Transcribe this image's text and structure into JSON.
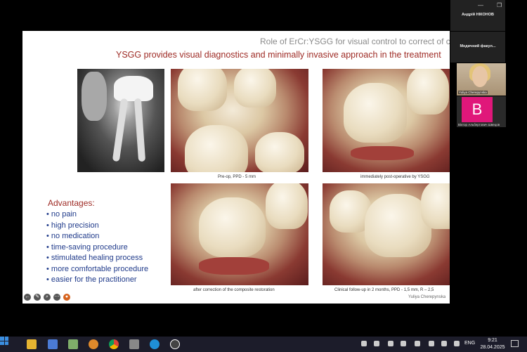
{
  "slide": {
    "header": "Role of ErCr:YSGG for visual control to correct of comp",
    "title": "YSGG provides visual diagnostics and minimally invasive approach in the treatment",
    "captions": [
      "Pre-op, PPD - 5 mm",
      "immediately post-operative by YSGG",
      "after correction of the composite restoration",
      "Clinical follow-up in 2 months, PPD - 1,5 mm, R – 2,5"
    ],
    "advantages_title": "Advantages:",
    "advantages": [
      "no pain",
      "high precision",
      "no medication",
      "time-saving procedure",
      "stimulated healing process",
      "more comfortable procedure",
      "easier for the practitioner"
    ],
    "author": "Yuliya Cherepynska"
  },
  "participants": [
    {
      "name": "Андрій НІКОНОВ"
    },
    {
      "name": "Медичний факул..."
    },
    {
      "name": "Yuliya Cherepynska"
    },
    {
      "name": "Віктор Альбертович Швецов",
      "initial": "B",
      "color": "#e0177a"
    }
  ],
  "taskbar": {
    "lang": "ENG",
    "time": "9:21",
    "date": "28.04.2025"
  }
}
